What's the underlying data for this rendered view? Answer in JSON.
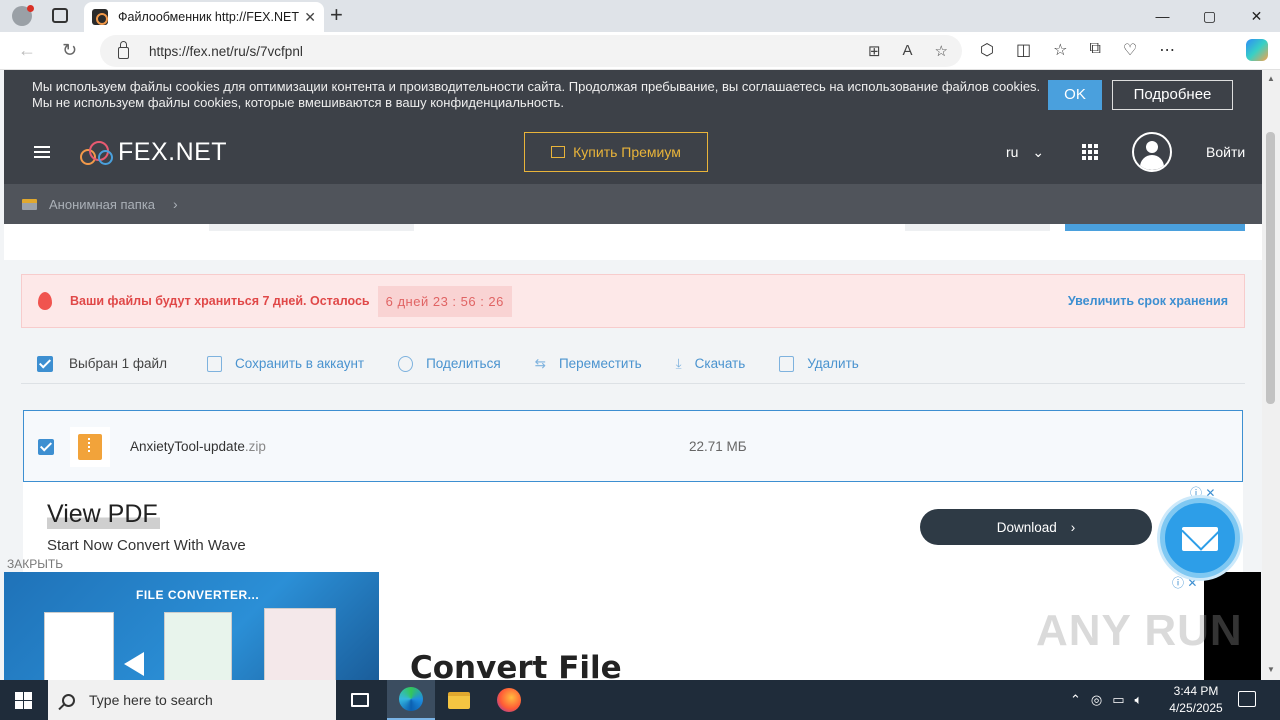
{
  "browser": {
    "tab_title": "Файлообменник http://FEX.NET",
    "tab_close": "✕",
    "new_tab": "+",
    "url": "https://fex.net/ru/s/7vcfpnl",
    "window_controls": [
      "—",
      "▢",
      "✕"
    ]
  },
  "cookie_bar": {
    "text": "Мы используем файлы cookies для оптимизации контента и производительности сайта. Продолжая пребывание, вы соглашаетесь на использование файлов cookies. Мы не используем файлы cookies, которые вмешиваются в вашу конфиденциальность.",
    "ok_label": "OK",
    "more_label": "Подробнее"
  },
  "header": {
    "logo_text": "FEX.NET",
    "premium_label": "Купить Премиум",
    "lang": "ru",
    "login_label": "Войти"
  },
  "breadcrumb": {
    "folder": "Анонимная папка",
    "separator": "›"
  },
  "storage_warning": {
    "message": "Ваши файлы будут храниться 7 дней. Осталось",
    "timer": "6 дней  23 : 56 : 26",
    "extend_label": "Увеличить срок хранения"
  },
  "actions": {
    "selected_label": "Выбран 1 файл",
    "save_label": "Сохранить в аккаунт",
    "share_label": "Поделиться",
    "move_label": "Переместить",
    "download_label": "Скачать",
    "delete_label": "Удалить"
  },
  "file": {
    "name": "AnxietyTool-update",
    "ext": ".zip",
    "size": "22.71 МБ"
  },
  "ad_top": {
    "headline": "View PDF",
    "subline": "Start Now Convert With Wave",
    "button_label": "Download",
    "ad_icons": "ⓘ ✕"
  },
  "ad_close_label": "ЗАКРЫТЬ",
  "ad_bottom": {
    "banner_text": "FILE CONVERTER...",
    "headline": "Convert File",
    "ad_icons": "ⓘ ✕"
  },
  "watermark": "ANY RUN",
  "taskbar": {
    "search_placeholder": "Type here to search",
    "time": "3:44 PM",
    "date": "4/25/2025"
  },
  "colors": {
    "accent": "#3d8fd1",
    "header_bg": "#3d4148",
    "premium_gold": "#e9b43a",
    "warning_red": "#e04848"
  }
}
